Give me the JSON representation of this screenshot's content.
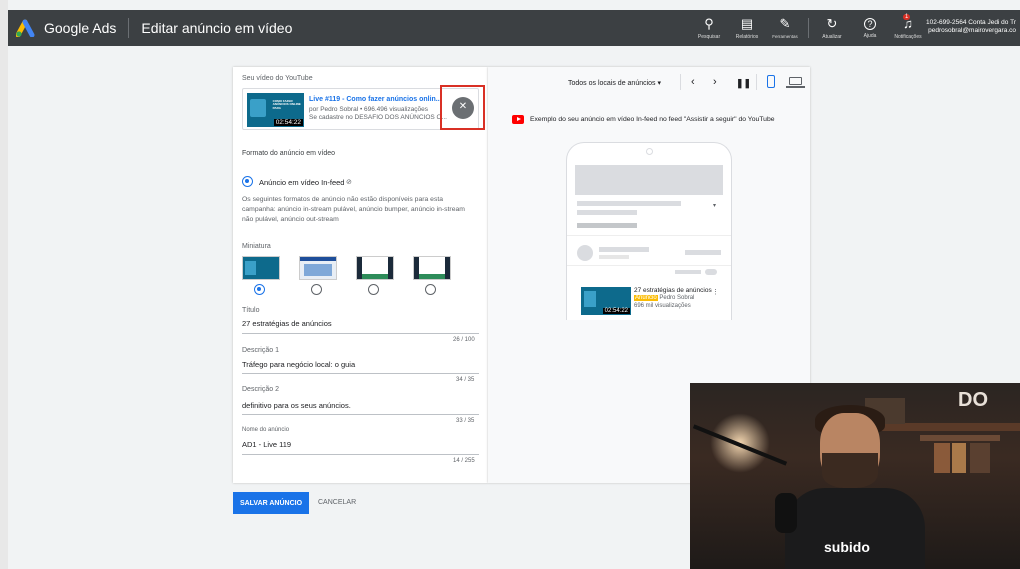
{
  "topbar": {
    "brand": "Google Ads",
    "page_title": "Editar anúncio em vídeo",
    "tools": [
      {
        "icon": "search-icon",
        "label": "Pesquisar",
        "glyph": "⚲"
      },
      {
        "icon": "reports-icon",
        "label": "Relatórios",
        "glyph": "▤"
      },
      {
        "icon": "wrench-icon",
        "label": "Ferramentas e configurações",
        "glyph": "✎"
      },
      {
        "icon": "refresh-icon",
        "label": "Atualizar",
        "glyph": "↻"
      },
      {
        "icon": "help-icon",
        "label": "Ajuda",
        "glyph": "?"
      },
      {
        "icon": "bell-icon",
        "label": "Notificações",
        "glyph": "🔔"
      }
    ],
    "notification_count": "1",
    "account_line1": "102-699-2564 Conta Jedi do Tr",
    "account_line2": "pedrosobral@mairovergara.co"
  },
  "editor": {
    "video_section_label": "Seu vídeo do YouTube",
    "video_title": "Live #119 - Como fazer anúncios onlin...",
    "video_meta": "por Pedro Sobral • 696.496 visualizações",
    "video_desc": "Se cadastre no DESAFIO DOS ANÚNCIOS O...",
    "video_duration": "02:54:22",
    "thumb_text": "COMO FAZER ANÚNCIOS ONLINE PARA",
    "format_label": "Formato do anúncio em vídeo",
    "format_option": "Anúncio em vídeo In-feed",
    "format_note": "Os seguintes formatos de anúncio não estão disponíveis para esta campanha: anúncio in-stream pulável, anúncio bumper, anúncio in-stream não pulável, anúncio out-stream",
    "thumbnail_label": "Miniatura",
    "title_label": "Título",
    "title_value": "27 estratégias de anúncios",
    "title_count": "26 / 100",
    "desc1_label": "Descrição 1",
    "desc1_value": "Tráfego para negócio local: o guia",
    "desc1_count": "34 / 35",
    "desc2_label": "Descrição 2",
    "desc2_value": "definitivo para os seus anúncios.",
    "desc2_count": "33 / 35",
    "name_label": "Nome do anúncio",
    "name_value": "AD1 - Live 119",
    "name_count": "14 / 255"
  },
  "actions": {
    "save": "SALVAR ANÚNCIO",
    "cancel": "CANCELAR"
  },
  "preview": {
    "locations": "Todos os locais de anúncios",
    "caption": "Exemplo do seu anúncio em vídeo In-feed no feed \"Assistir a seguir\" do YouTube",
    "ad_title": "27 estratégias de anúncios",
    "ad_badge": "Anúncio",
    "ad_channel": "Pedro Sobral",
    "ad_views": "696 mil visualizações",
    "ad_duration": "02:54:22"
  },
  "webcam": {
    "shirt_text": "subido",
    "wall_logo": "DO"
  },
  "colors": {
    "topbar": "#3c4043",
    "accent": "#1a73e8",
    "highlight": "#d93025",
    "youtube": "#ff0000"
  }
}
